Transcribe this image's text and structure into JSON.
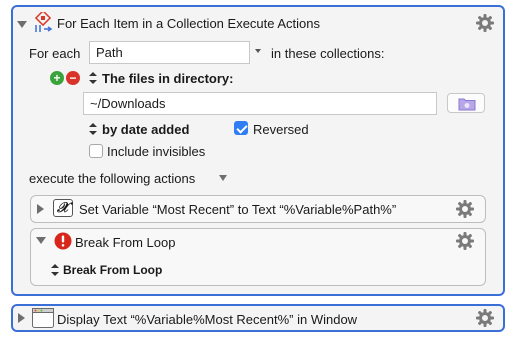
{
  "main_action": {
    "title": "For Each Item in a Collection Execute Actions",
    "for_each_label": "For each",
    "variable_value": "Path",
    "collections_label": "in these collections:",
    "collection_type": "The files in directory:",
    "directory_value": "~/Downloads",
    "sort_label": "by date added",
    "reversed_label": "Reversed",
    "reversed_checked": true,
    "invisibles_label": "Include invisibles",
    "invisibles_checked": false,
    "execute_label": "execute the following actions"
  },
  "sub_actions": [
    {
      "title": "Set Variable “Most Recent” to Text “%Variable%Path%”",
      "icon": "x-variable-icon"
    },
    {
      "title": "Break From Loop",
      "icon": "stop-icon",
      "option": "Break From Loop"
    }
  ],
  "bottom_action": {
    "title": "Display Text “%Variable%Most Recent%” in Window",
    "icon": "window-icon"
  },
  "colors": {
    "accent_border": "#3b6fd8",
    "checkbox_blue": "#2f7ef5"
  }
}
